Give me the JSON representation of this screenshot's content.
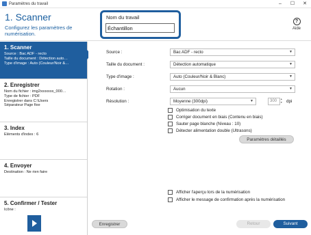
{
  "window": {
    "title": "Paramètres du travail"
  },
  "header": {
    "title": "1. Scanner",
    "subtitle": "Configurez les paramètres de numérisation.",
    "job_name_label": "Nom du travail",
    "job_name_value": "Échantillon",
    "help_label": "Aide"
  },
  "steps": [
    {
      "title": "1. Scanner",
      "lines": [
        "Source : Bac ADF - recto",
        "Taille du document : Détection auto…",
        "Type d'image : Auto (Couleur/Noir &…"
      ]
    },
    {
      "title": "2. Enregistrer",
      "lines": [
        "Nom du fichier : img2xxxxxxx_000…",
        "Type de fichier : PDF",
        "Enregistrer dans C:\\Users",
        "Séparateur Page fixe"
      ]
    },
    {
      "title": "3. Index",
      "lines": [
        "Éléments d'index : 6"
      ]
    },
    {
      "title": "4. Envoyer",
      "lines": [
        "Destination : Ne rien faire"
      ]
    },
    {
      "title": "5. Confirmer / Tester",
      "lines": [
        "Icône :"
      ]
    }
  ],
  "form": {
    "source": {
      "label": "Source :",
      "value": "Bac ADF - recto"
    },
    "doc_size": {
      "label": "Taille du document :",
      "value": "Détection automatique"
    },
    "image_type": {
      "label": "Type d'image :",
      "value": "Auto (Couleur/Noir & Blanc)"
    },
    "rotation": {
      "label": "Rotation :",
      "value": "Aucun"
    },
    "resolution": {
      "label": "Résolution :",
      "value": "Moyenne (300dpi)",
      "dpi_value": "300",
      "unit": "dpi"
    },
    "checks": [
      {
        "label": "Optimisation du texte",
        "checked": false
      },
      {
        "label": "Corriger document en biais (Contenu en biais)",
        "checked": false
      },
      {
        "label": "Sauter page blanche (Niveau : 10)",
        "checked": false
      },
      {
        "label": "Détecter alimentation double (Ultrasons)",
        "checked": false
      }
    ],
    "advanced_button": "Paramètres détaillés",
    "bottom_checks": [
      {
        "label": "Afficher l'aperçu lors de la numérisation",
        "checked": false
      },
      {
        "label": "Afficher le message de confirmation après la numérisation",
        "checked": false
      }
    ]
  },
  "footer": {
    "save_label": "Enregistrer",
    "back_label": "Retour",
    "next_label": "Suivant"
  },
  "colors": {
    "accent": "#1f5e9e",
    "title_blue": "#1a5fa0"
  }
}
